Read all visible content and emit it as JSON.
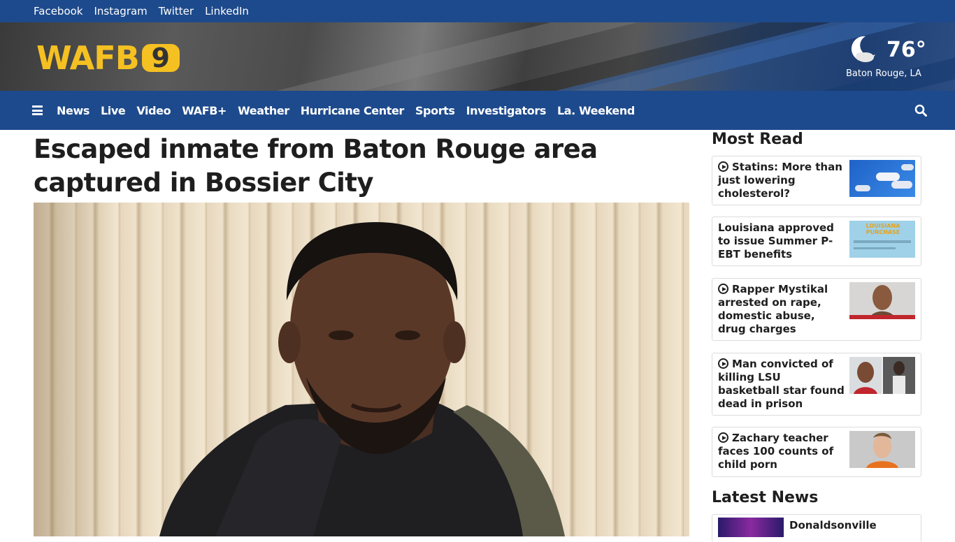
{
  "social": {
    "links": [
      "Facebook",
      "Instagram",
      "Twitter",
      "LinkedIn"
    ]
  },
  "header": {
    "logo_text": "WAFB",
    "logo_number": "9",
    "weather": {
      "temp": "76°",
      "location": "Baton Rouge, LA",
      "icon": "moon-cloud-icon"
    }
  },
  "nav": {
    "items": [
      "News",
      "Live",
      "Video",
      "WAFB+",
      "Weather",
      "Hurricane Center",
      "Sports",
      "Investigators",
      "La. Weekend"
    ]
  },
  "article": {
    "headline": "Escaped inmate from Baton Rouge area captured in Bossier City"
  },
  "most_read": {
    "title": "Most Read",
    "items": [
      {
        "title": "Statins: More than just lowering cholesterol?",
        "video": true,
        "thumb": "pills"
      },
      {
        "title": "Louisiana approved to issue Summer P-EBT benefits",
        "video": false,
        "thumb": "ebt-card",
        "thumb_text": "LOUISIANA PURCHASE"
      },
      {
        "title": "Rapper Mystikal arrested on rape, domestic abuse, drug charges",
        "video": true,
        "thumb": "mugshot"
      },
      {
        "title": "Man convicted of killing LSU basketball star found dead in prison",
        "video": true,
        "thumb": "two-photos"
      },
      {
        "title": "Zachary teacher faces 100 counts of child porn",
        "video": true,
        "thumb": "mugshot-orange"
      }
    ]
  },
  "latest_news": {
    "title": "Latest News",
    "items": [
      {
        "title": "Donaldsonville"
      }
    ]
  },
  "colors": {
    "brand_blue": "#1d4a8c",
    "logo_gold": "#f5c022"
  }
}
